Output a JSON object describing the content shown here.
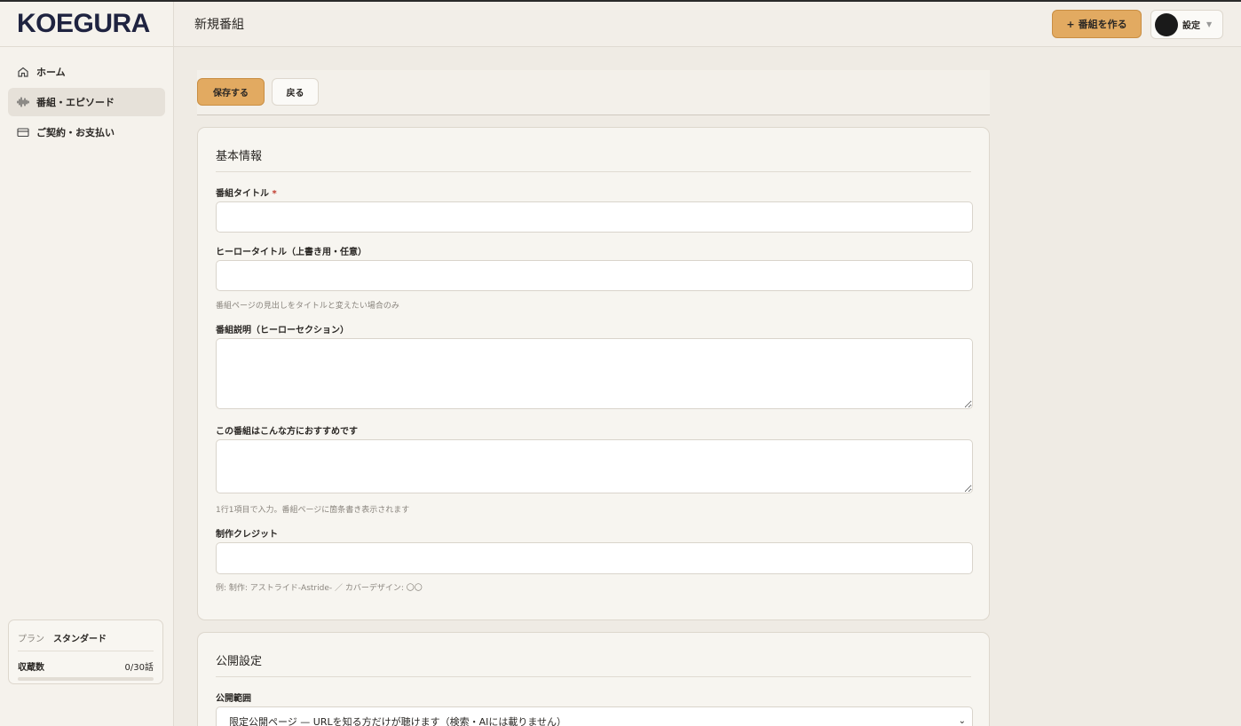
{
  "brand": {
    "logo": "KOEGURA"
  },
  "sidebar": {
    "items": [
      {
        "label": "ホーム",
        "icon": "home-icon"
      },
      {
        "label": "番組・エピソード",
        "icon": "waveform-icon"
      },
      {
        "label": "ご契約・お支払い",
        "icon": "credit-card-icon"
      }
    ],
    "active_index": 1,
    "plan": {
      "plan_label": "プラン",
      "plan_value": "スタンダード",
      "count_label": "収蔵数",
      "count_value": "0/30話",
      "progress": 0.0
    }
  },
  "header": {
    "title": "新規番組",
    "create_button": "番組を作る",
    "settings_label": "設定"
  },
  "toolbar": {
    "save_label": "保存する",
    "back_label": "戻る"
  },
  "basic_info": {
    "title": "基本情報",
    "program_title_label": "番組タイトル",
    "required_mark": "*",
    "program_title_value": "",
    "hero_title_label": "ヒーロータイトル（上書き用・任意）",
    "hero_title_value": "",
    "hero_title_hint": "番組ページの見出しをタイトルと変えたい場合のみ",
    "description_label": "番組説明（ヒーローセクション）",
    "description_value": "",
    "recommended_label": "この番組はこんな方におすすめです",
    "recommended_value": "",
    "recommended_hint": "1行1項目で入力。番組ページに箇条書き表示されます",
    "credit_label": "制作クレジット",
    "credit_value": "",
    "credit_hint": "例: 制作: アストライド-Astride- ／ カバーデザイン: 〇〇"
  },
  "publish": {
    "title": "公開設定",
    "scope_label": "公開範囲",
    "scope_selected": "限定公開ページ — URLを知る方だけが聴けます（検索・AIには載りません）"
  },
  "colors": {
    "accent": "#e2aa61",
    "background": "#efebe4",
    "sidebar": "#f5f2ec"
  }
}
